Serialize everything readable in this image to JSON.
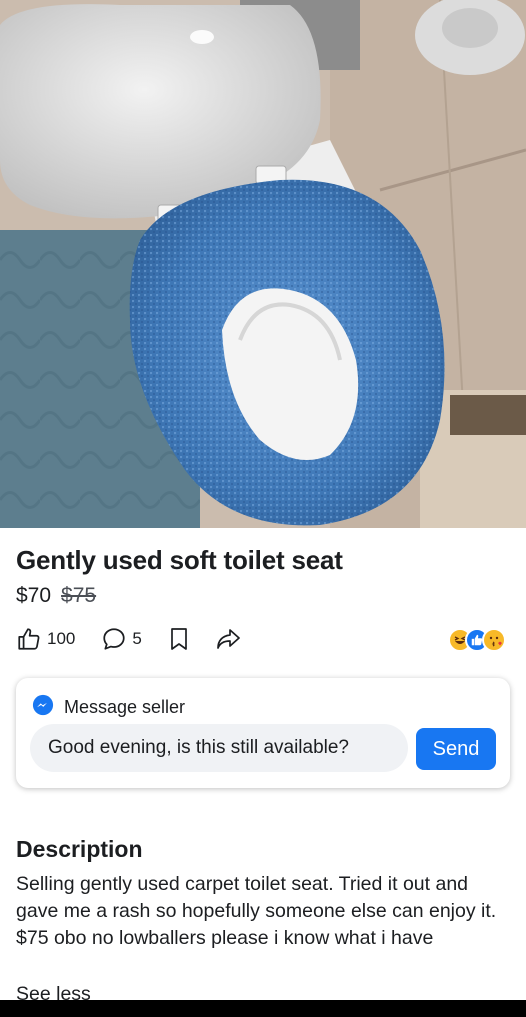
{
  "listing": {
    "title": "Gently used soft toilet seat",
    "price": "$70",
    "original_price": "$75",
    "like_count": "100",
    "comment_count": "5"
  },
  "message": {
    "header": "Message seller",
    "input_value": "Good evening, is this still available?",
    "send_label": "Send"
  },
  "description": {
    "heading": "Description",
    "text": "Selling gently used carpet toilet seat. Tried it out and gave me a rash so hopefully someone else can enjoy it. $75 obo no lowballers please i know what i have",
    "toggle_label": "See less"
  },
  "icons": {
    "like": "thumbs-up-icon",
    "comment": "comment-bubble-icon",
    "save": "bookmark-icon",
    "share": "share-arrow-icon",
    "messenger": "messenger-icon",
    "reactions": [
      "laughing-emoji-icon",
      "like-reaction-icon",
      "kiss-emoji-icon"
    ]
  },
  "colors": {
    "accent": "#1877f2",
    "card_input_bg": "#f0f2f5",
    "seat_cover": "#3f78b8"
  }
}
